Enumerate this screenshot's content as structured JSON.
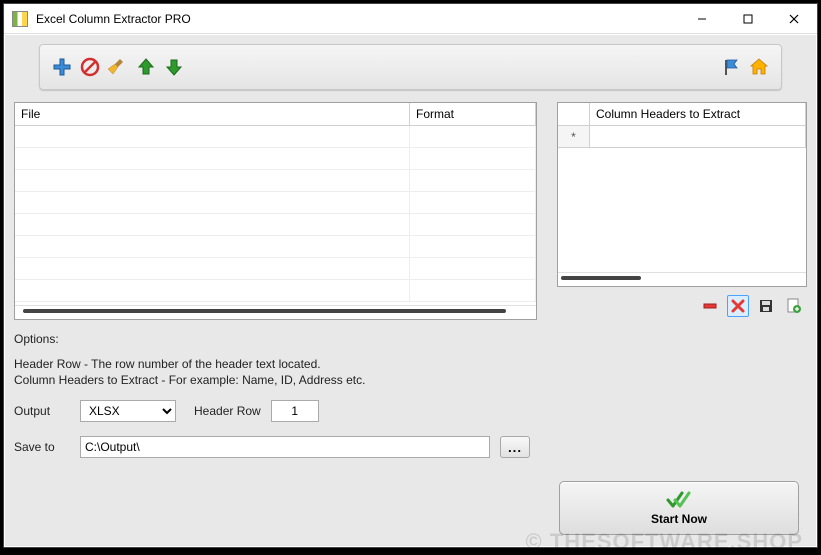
{
  "window": {
    "title": "Excel Column Extractor PRO"
  },
  "toolbar": {
    "add": "add",
    "block": "block",
    "clean": "clean",
    "up": "up",
    "down": "down",
    "flag": "flag",
    "home": "home"
  },
  "file_grid": {
    "columns": {
      "file": "File",
      "format": "Format"
    },
    "rows": []
  },
  "headers_grid": {
    "header": "Column Headers to Extract",
    "selector_marker": "*",
    "rows": [
      ""
    ]
  },
  "headers_actions": {
    "remove": "remove",
    "delete": "delete",
    "save": "save",
    "export": "export"
  },
  "options": {
    "heading": "Options:",
    "help1": "Header Row - The row number of the header text located.",
    "help2": "Column Headers to Extract - For example: Name, ID, Address etc.",
    "output_label": "Output",
    "output_value": "XLSX",
    "header_row_label": "Header Row",
    "header_row_value": "1",
    "save_to_label": "Save to",
    "save_to_value": "C:\\Output\\",
    "browse_label": "..."
  },
  "start": {
    "label": "Start Now"
  },
  "watermark": "© THESOFTWARE.SHOP"
}
